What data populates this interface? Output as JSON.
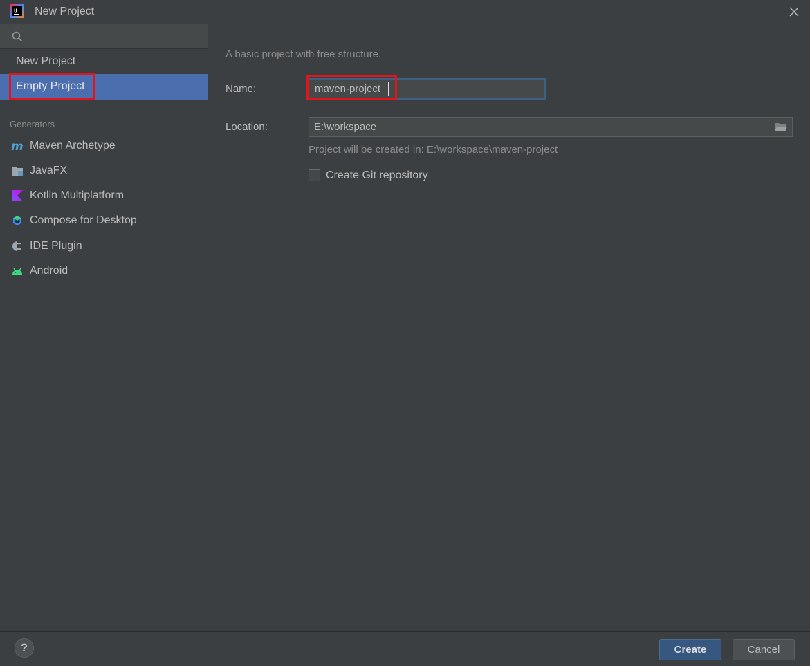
{
  "window": {
    "title": "New Project",
    "app_icon": "intellij-idea-icon",
    "close_icon": "close-icon"
  },
  "sidebar": {
    "search": {
      "value": "",
      "placeholder": ""
    },
    "items": [
      {
        "label": "New Project",
        "selected": false
      },
      {
        "label": "Empty Project",
        "selected": true
      }
    ],
    "generators_header": "Generators",
    "generators": [
      {
        "label": "Maven Archetype",
        "icon": "maven-icon"
      },
      {
        "label": "JavaFX",
        "icon": "javafx-icon"
      },
      {
        "label": "Kotlin Multiplatform",
        "icon": "kotlin-icon"
      },
      {
        "label": "Compose for Desktop",
        "icon": "compose-icon"
      },
      {
        "label": "IDE Plugin",
        "icon": "ide-plugin-icon"
      },
      {
        "label": "Android",
        "icon": "android-icon"
      }
    ]
  },
  "main": {
    "description": "A basic project with free structure.",
    "name_label": "Name:",
    "name_value": "maven-project",
    "location_label": "Location:",
    "location_value": "E:\\workspace",
    "hint": "Project will be created in: E:\\workspace\\maven-project",
    "git_checkbox_label": "Create Git repository",
    "git_checked": false
  },
  "footer": {
    "help_label": "?",
    "create_label": "Create",
    "cancel_label": "Cancel"
  },
  "colors": {
    "background": "#3c3f41",
    "selection": "#4b6eaf",
    "annotation": "#e4141a",
    "primary_button": "#365880"
  }
}
